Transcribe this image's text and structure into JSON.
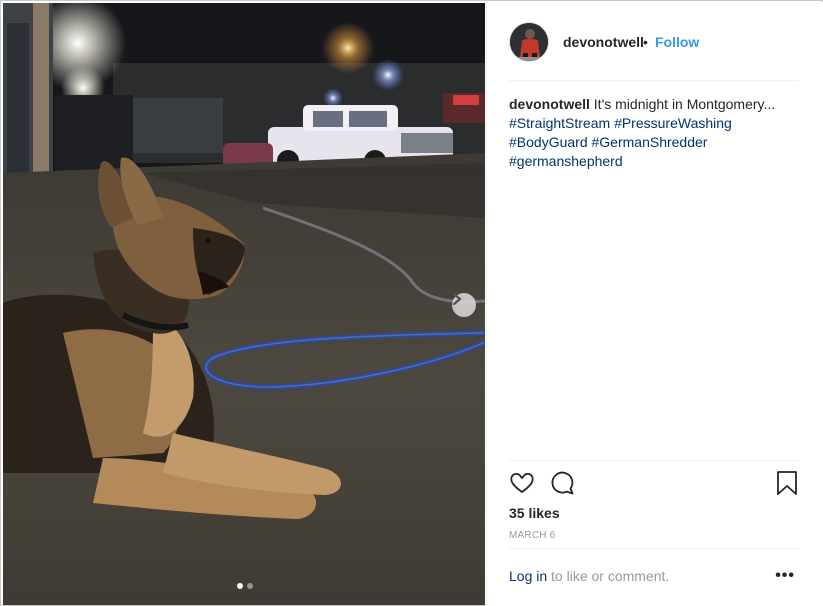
{
  "post": {
    "username": "devonotwell",
    "separator": "•",
    "follow_label": "Follow",
    "caption_text": "It's midnight in Montgomery...",
    "hashtags": [
      "#StraightStream",
      "#PressureWashing",
      "#BodyGuard",
      "#GermanShredder",
      "#germanshepherd"
    ],
    "likes": "35 likes",
    "date": "MARCH 6",
    "login_link": "Log in",
    "login_rest": " to like or comment.",
    "more_label": "•••"
  },
  "media": {
    "carousel_count": 2,
    "carousel_active": 1
  },
  "icons": {
    "like": "heart-icon",
    "comment": "comment-icon",
    "save": "bookmark-icon",
    "next": "chevron-right-icon",
    "more": "more-options-icon"
  },
  "colors": {
    "link": "#003569",
    "follow": "#3897f0",
    "text": "#262626",
    "muted": "#999999"
  }
}
